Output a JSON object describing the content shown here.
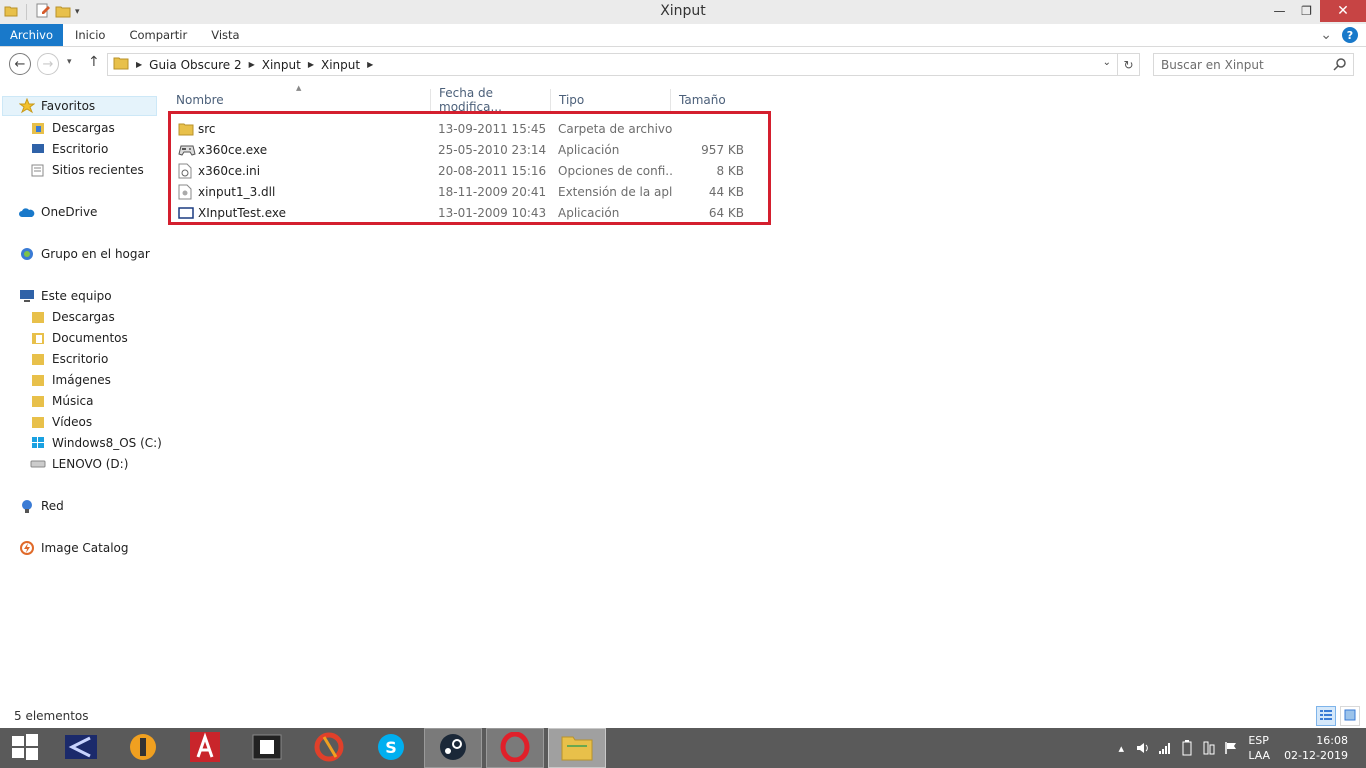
{
  "window": {
    "title": "Xinput",
    "minimize_glyph": "—",
    "maximize_glyph": "❐",
    "close_glyph": "✕"
  },
  "ribbon": {
    "tabs": [
      "Archivo",
      "Inicio",
      "Compartir",
      "Vista"
    ],
    "help_glyph": "?",
    "expand_glyph": "⌄"
  },
  "address": {
    "breadcrumb": [
      "Guia Obscure 2",
      "Xinput",
      "Xinput"
    ],
    "search_placeholder": "Buscar en Xinput"
  },
  "nav": {
    "favorites": {
      "label": "Favoritos",
      "items": [
        "Descargas",
        "Escritorio",
        "Sitios recientes"
      ]
    },
    "onedrive": "OneDrive",
    "homegroup": "Grupo en el hogar",
    "thispc": {
      "label": "Este equipo",
      "items": [
        "Descargas",
        "Documentos",
        "Escritorio",
        "Imágenes",
        "Música",
        "Vídeos",
        "Windows8_OS (C:)",
        "LENOVO (D:)"
      ]
    },
    "network": "Red",
    "catalog": "Image Catalog"
  },
  "list": {
    "columns": [
      "Nombre",
      "Fecha de modifica...",
      "Tipo",
      "Tamaño"
    ],
    "sort_glyph": "▲",
    "files": [
      {
        "name": "src",
        "date": "13-09-2011 15:45",
        "type": "Carpeta de archivos",
        "size": "",
        "icon": "folder-icon"
      },
      {
        "name": "x360ce.exe",
        "date": "25-05-2010 23:14",
        "type": "Aplicación",
        "size": "957 KB",
        "icon": "gamepad-icon"
      },
      {
        "name": "x360ce.ini",
        "date": "20-08-2011 15:16",
        "type": "Opciones de confi...",
        "size": "8 KB",
        "icon": "settings-file-icon"
      },
      {
        "name": "xinput1_3.dll",
        "date": "18-11-2009 20:41",
        "type": "Extensión de la apl...",
        "size": "44 KB",
        "icon": "dll-file-icon"
      },
      {
        "name": "XInputTest.exe",
        "date": "13-01-2009 10:43",
        "type": "Aplicación",
        "size": "64 KB",
        "icon": "app-window-icon"
      }
    ]
  },
  "status": {
    "count": "5 elementos"
  },
  "tray": {
    "lang1": "ESP",
    "lang2": "LAA",
    "time": "16:08",
    "date": "02-12-2019"
  },
  "colors": {
    "accent": "#1979ca",
    "highlight": "#d41f2e",
    "taskbar": "#5a5a5a"
  }
}
